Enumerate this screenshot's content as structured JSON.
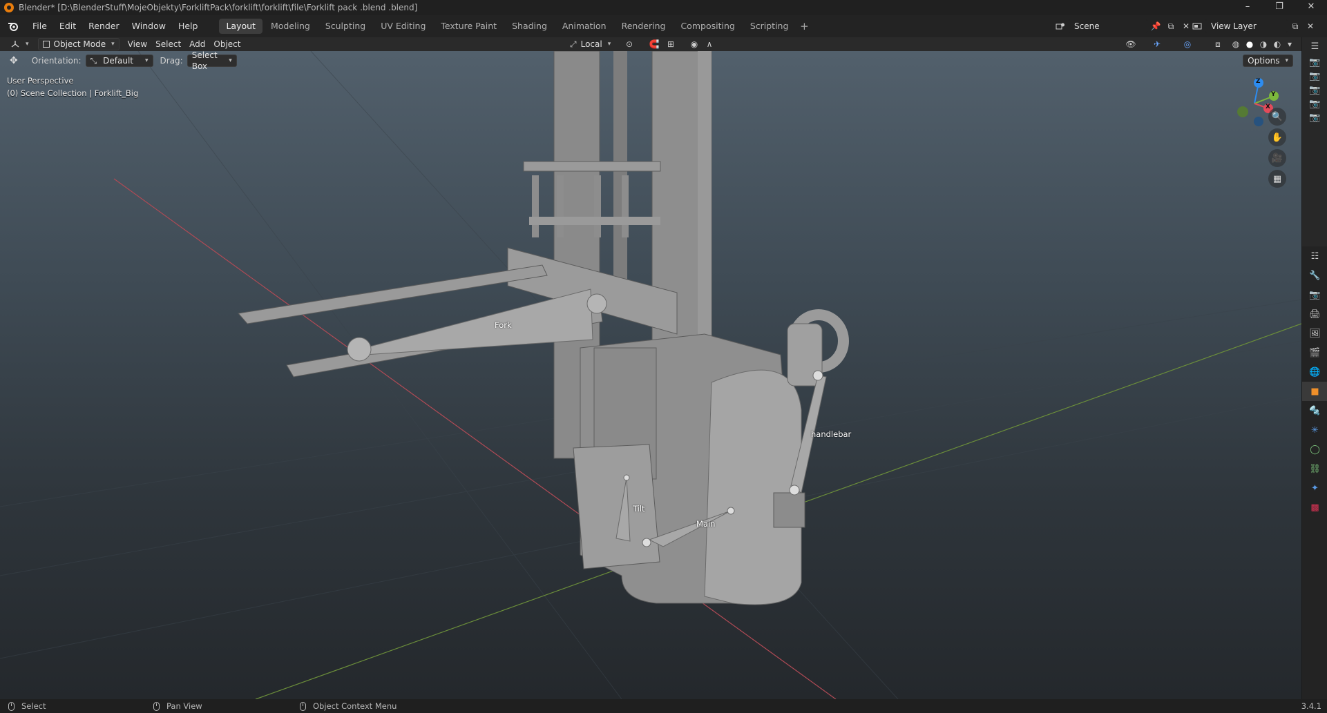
{
  "window": {
    "title": "Blender* [D:\\BlenderStuff\\MojeObjekty\\ForkliftPack\\forklift\\forklift\\file\\Forklift pack .blend .blend]",
    "controls": [
      "–",
      "❐",
      "✕"
    ]
  },
  "menubar": {
    "items": [
      "File",
      "Edit",
      "Render",
      "Window",
      "Help"
    ]
  },
  "workspaces": {
    "tabs": [
      "Layout",
      "Modeling",
      "Sculpting",
      "UV Editing",
      "Texture Paint",
      "Shading",
      "Animation",
      "Rendering",
      "Compositing",
      "Scripting"
    ],
    "active": "Layout",
    "add": "+"
  },
  "scene": {
    "name": "Scene"
  },
  "view_layer": {
    "name": "View Layer"
  },
  "header": {
    "mode": "Object Mode",
    "menus": [
      "View",
      "Select",
      "Add",
      "Object"
    ],
    "transform_orientation": "Local"
  },
  "tool_settings": {
    "orientation_label": "Orientation:",
    "orientation_value": "Default",
    "drag_label": "Drag:",
    "drag_value": "Select Box",
    "options": "Options"
  },
  "viewport": {
    "perspective": "User Perspective",
    "collection": "(0) Scene Collection | Forklift_Big",
    "bones": [
      "Fork",
      "handlebar",
      "Tilt",
      "Main"
    ],
    "gizmo_axes": [
      "Z",
      "Y",
      "X"
    ],
    "colors": {
      "x_axis": "#e24b5a",
      "y_axis": "#7cb83c",
      "z_axis": "#2d8cf0"
    }
  },
  "statusbar": {
    "left": "Select",
    "middle": "Pan View",
    "right": "Object Context Menu",
    "version": "3.4.1"
  }
}
